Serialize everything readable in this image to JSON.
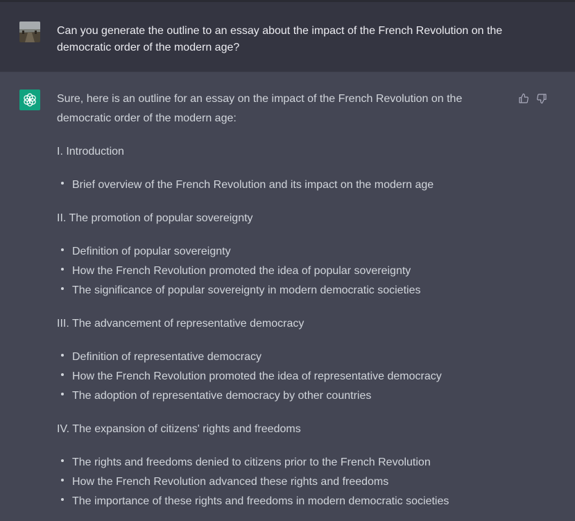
{
  "user_message": {
    "avatar_icon": "user-photo-avatar",
    "text": "Can you generate the outline to an essay about the impact of the French Revolution on the\ndemocratic order of the modern age?"
  },
  "assistant_message": {
    "avatar_icon": "openai-logo-icon",
    "avatar_color": "#10a37f",
    "intro": "Sure, here is an outline for an essay on the impact of the French Revolution on the democratic order of the modern age:",
    "feedback": {
      "thumbs_up_icon": "thumbs-up-icon",
      "thumbs_down_icon": "thumbs-down-icon"
    },
    "sections": [
      {
        "heading": "I. Introduction",
        "bullets": [
          "Brief overview of the French Revolution and its impact on the modern age"
        ]
      },
      {
        "heading": "II. The promotion of popular sovereignty",
        "bullets": [
          "Definition of popular sovereignty",
          "How the French Revolution promoted the idea of popular sovereignty",
          "The significance of popular sovereignty in modern democratic societies"
        ]
      },
      {
        "heading": "III. The advancement of representative democracy",
        "bullets": [
          "Definition of representative democracy",
          "How the French Revolution promoted the idea of representative democracy",
          "The adoption of representative democracy by other countries"
        ]
      },
      {
        "heading": "IV. The expansion of citizens' rights and freedoms",
        "bullets": [
          "The rights and freedoms denied to citizens prior to the French Revolution",
          "How the French Revolution advanced these rights and freedoms",
          "The importance of these rights and freedoms in modern democratic societies"
        ]
      }
    ]
  },
  "colors": {
    "user_row_bg": "#343541",
    "assistant_row_bg": "#444654",
    "text": "#d1d5db",
    "accent": "#10a37f"
  }
}
